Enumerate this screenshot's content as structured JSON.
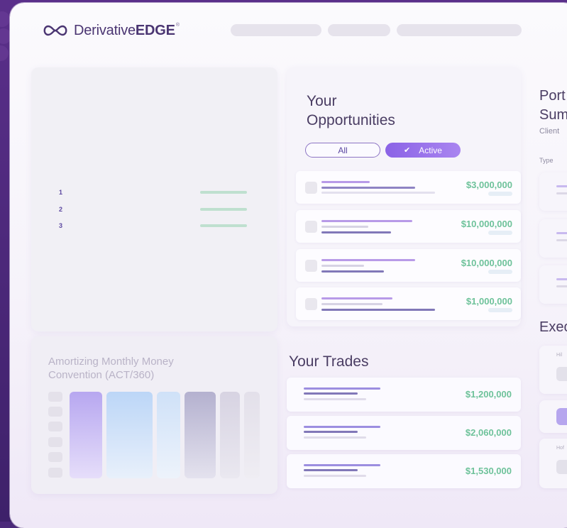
{
  "brand": {
    "name_light": "Derivative",
    "name_bold": "EDGE",
    "registered_mark": "®"
  },
  "rank_list": {
    "items": [
      "1",
      "2",
      "3"
    ]
  },
  "amortization": {
    "title": "Amortizing Monthly Money Convention (ACT/360)"
  },
  "opportunities": {
    "title": "Your Opportunities",
    "filters": [
      {
        "label": "All",
        "active": false
      },
      {
        "label": "Active",
        "active": true
      }
    ],
    "rows": [
      {
        "amount": "$3,000,000"
      },
      {
        "amount": "$10,000,000"
      },
      {
        "amount": "$10,000,000"
      },
      {
        "amount": "$1,000,000"
      }
    ]
  },
  "trades": {
    "title": "Your Trades",
    "rows": [
      {
        "amount": "$1,200,000"
      },
      {
        "amount": "$2,060,000"
      },
      {
        "amount": "$1,530,000"
      }
    ]
  },
  "portfolio": {
    "title": "Portfolio Summary",
    "title_visible": [
      "Port",
      "Sum"
    ],
    "client_label": "Client",
    "type_label": "Type"
  },
  "execution": {
    "title_visible": "Exec",
    "labels": [
      "Hil",
      "Hof"
    ]
  },
  "colors": {
    "accent_purple": "#8b63e6",
    "amount_green": "#6ec29a",
    "heading": "#4a3d63"
  }
}
